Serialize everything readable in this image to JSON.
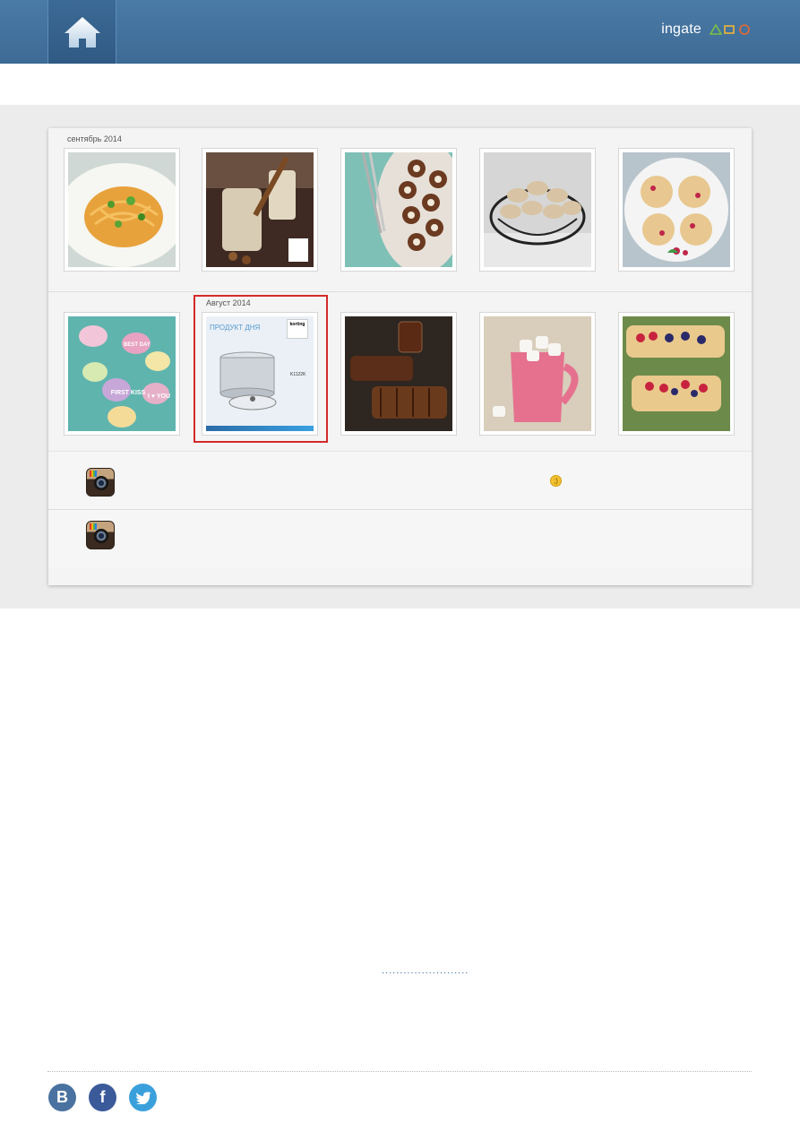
{
  "header": {
    "home_icon": "home-icon",
    "brand_name": "ingate",
    "brand_logo": "agency-logo"
  },
  "gallery": {
    "september_label": "сентябрь 2014",
    "august_label": "Август 2014",
    "row1": [
      {
        "name": "photo-spaghetti"
      },
      {
        "name": "photo-hazelnut-drink"
      },
      {
        "name": "photo-donuts"
      },
      {
        "name": "photo-macarons"
      },
      {
        "name": "photo-muffins"
      }
    ],
    "row2": [
      {
        "name": "photo-candy-hearts"
      },
      {
        "name": "photo-steamer-pot",
        "title": "ПРОДУКТ ДНЯ",
        "brand": "korting",
        "model": "K1122K"
      },
      {
        "name": "photo-ribs"
      },
      {
        "name": "photo-cocoa-mug"
      },
      {
        "name": "photo-berry-tarts"
      }
    ],
    "candy_texts": [
      "FIRST KISS",
      "I ♥ YOU",
      "BEST DAY"
    ]
  },
  "instagram_rows": [
    {
      "icon": "instagram-icon",
      "emoji": "wink-emoji"
    },
    {
      "icon": "instagram-icon"
    }
  ],
  "link_dots": "........................",
  "social": [
    {
      "name": "vk-icon",
      "label": "B",
      "color": "#4a72a0"
    },
    {
      "name": "facebook-icon",
      "label": "f",
      "color": "#3b5a9a"
    },
    {
      "name": "twitter-icon",
      "label": "t",
      "color": "#3aa0dc"
    }
  ]
}
